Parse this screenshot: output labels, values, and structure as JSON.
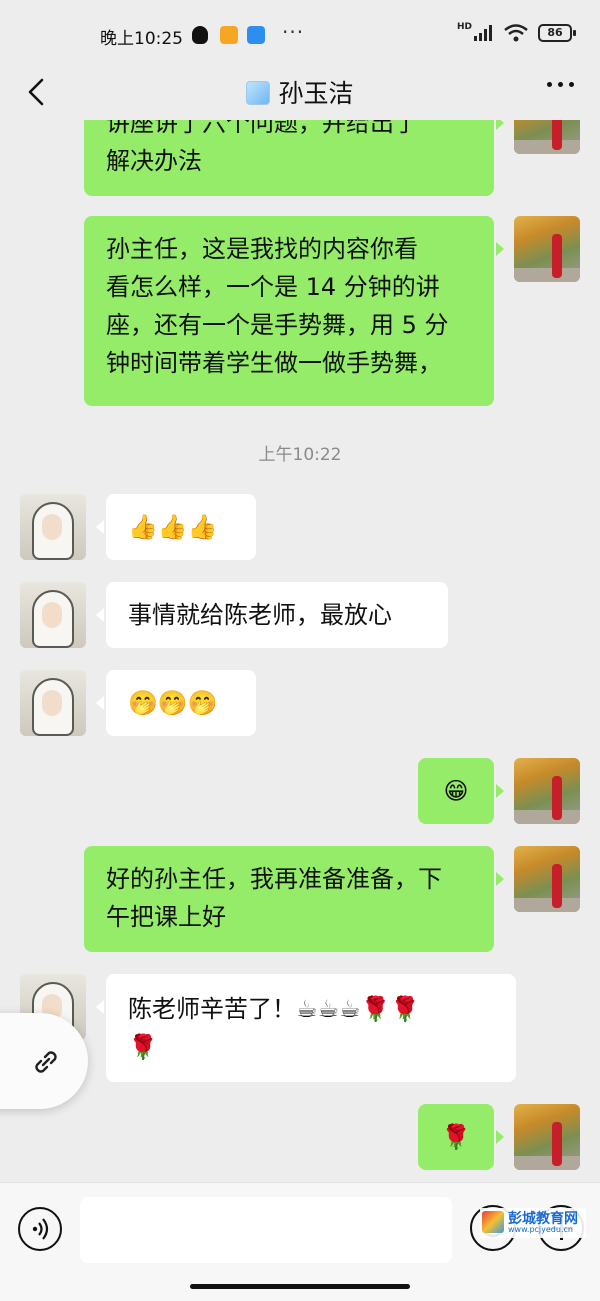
{
  "status": {
    "time": "晚上10:25",
    "dots": "···",
    "network": "HD",
    "battery": "86"
  },
  "header": {
    "title": "孙玉洁"
  },
  "messages": {
    "m1_line1": "讲座讲了六个问题，并给出了",
    "m1_line2": "解决办法",
    "m2_line1": "孙主任，这是我找的内容你看",
    "m2_line2": "看怎么样，一个是 14 分钟的讲",
    "m2_line3": "座，还有一个是手势舞，用 5 分",
    "m2_line4": "钟时间带着学生做一做手势舞，",
    "time1": "上午10:22",
    "m3": "👍👍👍",
    "m4": "事情就给陈老师，最放心",
    "m5": "🤭🤭🤭",
    "m6": "😁",
    "m7_line1": "好的孙主任，我再准备准备，下",
    "m7_line2": "午把课上好",
    "m8_line1": "陈老师辛苦了！☕☕☕🌹🌹",
    "m8_line2": "🌹",
    "m9": "🌹"
  },
  "input": {
    "value": ""
  },
  "watermark": {
    "name": "彭城教育网",
    "url": "www.pcjyedu.cn"
  },
  "colors": {
    "me_bubble": "#95ec69",
    "them_bubble": "#ffffff",
    "background": "#ededed"
  }
}
